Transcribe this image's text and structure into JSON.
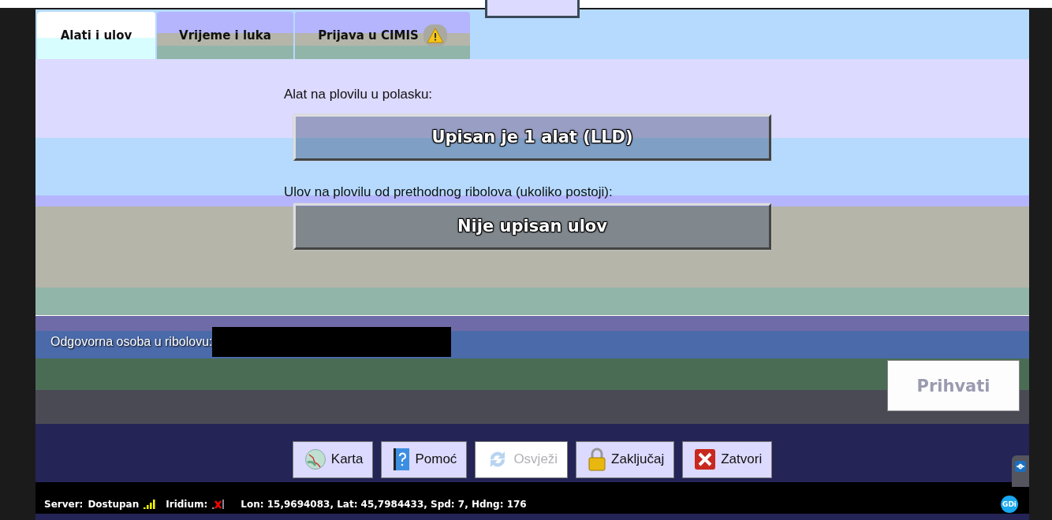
{
  "tabs": [
    {
      "label": "Alati i ulov",
      "selected": true,
      "warning": false
    },
    {
      "label": "Vrijeme i luka",
      "selected": false,
      "warning": false
    },
    {
      "label": "Prijava u CIMIS",
      "selected": false,
      "warning": true
    }
  ],
  "form": [
    {
      "label": "Alat na plovilu u polasku:",
      "button": "Upisan je 1 alat (LLD)"
    },
    {
      "label": "Ulov na plovilu od prethodnog ribolova (ukoliko postoji):",
      "button": "Nije upisan ulov"
    }
  ],
  "responsible_person": {
    "label": "Odgovorna osoba u ribolovu:"
  },
  "accept_button": {
    "label": "Prihvati",
    "disabled": true
  },
  "toolbar": [
    {
      "label": "Karta",
      "kind": "map",
      "disabled": false
    },
    {
      "label": "Pomoć",
      "kind": "help",
      "disabled": false
    },
    {
      "label": "Osvježi",
      "kind": "refresh",
      "disabled": true
    },
    {
      "label": "Zaključaj",
      "kind": "lock",
      "disabled": false
    },
    {
      "label": "Zatvori",
      "kind": "close",
      "disabled": false
    }
  ],
  "status_bar": {
    "server_label": "Server:",
    "server_value": "Dostupan",
    "server_connected": true,
    "iridium_label": "Iridium:",
    "iridium_connected": false,
    "position": "Lon: 15,9694083, Lat: 45,7984433, Spd: 7, Hdng: 176",
    "logo": "GDi"
  }
}
